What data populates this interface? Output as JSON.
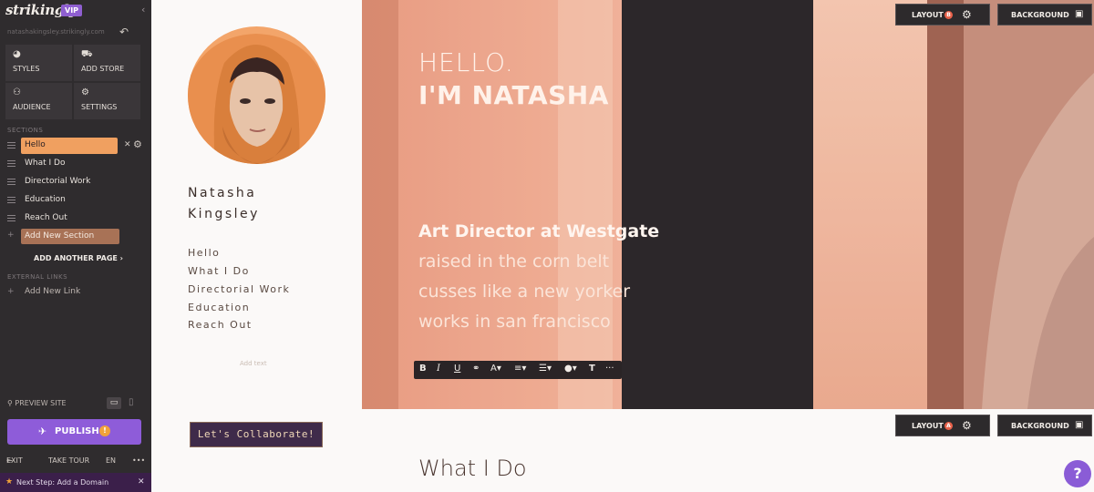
{
  "editor": {
    "logo": "strikingly",
    "vip_badge": "VIP",
    "site_url": "natashakingsley.strikingly.com",
    "tiles": [
      {
        "label": "STYLES",
        "icon": "palette-icon"
      },
      {
        "label": "ADD STORE",
        "icon": "store-icon"
      },
      {
        "label": "AUDIENCE",
        "icon": "people-icon"
      },
      {
        "label": "SETTINGS",
        "icon": "gear-icon"
      }
    ],
    "sections_heading": "SECTIONS",
    "sections": [
      "Hello",
      "What I Do",
      "Directorial Work",
      "Education",
      "Reach Out"
    ],
    "add_section": "Add New Section",
    "add_page": "ADD ANOTHER PAGE",
    "external_links_heading": "EXTERNAL LINKS",
    "add_link": "Add New Link",
    "preview_site": "PREVIEW SITE",
    "publish": "PUBLISH",
    "bottom": {
      "exit": "EXIT",
      "tour": "TAKE TOUR",
      "lang": "EN",
      "more": "•••"
    },
    "next_step": "Next Step: Add a Domain"
  },
  "site": {
    "name_first": "Natasha",
    "name_last": "Kingsley",
    "nav": [
      "Hello",
      "What I Do",
      "Directorial Work",
      "Education",
      "Reach Out"
    ],
    "add_text": "Add text",
    "cta": "Let's Collaborate!",
    "hero": {
      "hello": "HELLO.",
      "name": "I'M NATASHA",
      "role": "Art Director at Westgate",
      "lines": [
        "raised in the corn belt",
        "cusses like a new yorker",
        "works in san francisco"
      ]
    },
    "layout_label": "LAYOUT",
    "layout_top_badge": "B",
    "layout_bottom_badge": "A",
    "background_label": "BACKGROUND",
    "section_title": "What I Do"
  },
  "colors": {
    "accent": "#f0a060",
    "publish": "#8e5cd9",
    "sidebar": "#2f2c2e"
  }
}
